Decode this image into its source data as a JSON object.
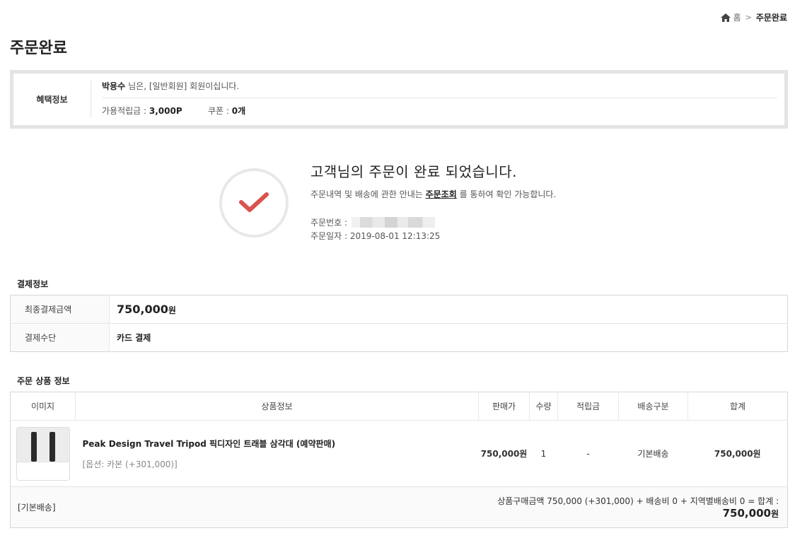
{
  "breadcrumb": {
    "home": "홈",
    "current": "주문완료"
  },
  "page_title": "주문완료",
  "benefit": {
    "label": "혜택정보",
    "user_name": "박용수",
    "member_text": "님은, [일반회원] 회원이십니다.",
    "points_label": "가용적립금 : ",
    "points_value": "3,000P",
    "coupon_label": "쿠폰 : ",
    "coupon_value": "0개"
  },
  "complete": {
    "heading": "고객님의 주문이 완료 되었습니다.",
    "desc_before": "주문내역 및 배송에 관한 안내는 ",
    "desc_link": "주문조회",
    "desc_after": " 를 통하여 확인 가능합니다.",
    "order_no_label": "주문번호 :",
    "order_date_label": "주문일자 : ",
    "order_date": "2019-08-01 12:13:25"
  },
  "payment": {
    "section_title": "결제정보",
    "final_label": "최종결제금액",
    "final_amount": "750,000",
    "won": "원",
    "method_label": "결제수단",
    "method_value": "카드 결제"
  },
  "products": {
    "section_title": "주문 상품 정보",
    "headers": [
      "이미지",
      "상품정보",
      "판매가",
      "수량",
      "적립금",
      "배송구분",
      "합계"
    ],
    "items": [
      {
        "name": "Peak Design Travel Tripod 픽디자인 트래블 삼각대 (예약판매)",
        "option": "[옵션: 카본 (+301,000)]",
        "price": "750,000원",
        "qty": "1",
        "points": "-",
        "shipping": "기본배송",
        "total": "750,000원"
      }
    ],
    "summary_left": "[기본배송]",
    "summary_text": "상품구매금액 750,000 (+301,000) + 배송비 0 + 지역별배송비 0 = 합계 :",
    "grand_total": "750,000",
    "won": "원"
  },
  "colors": {
    "check": "#d9534f",
    "border": "#e4e4e4"
  }
}
